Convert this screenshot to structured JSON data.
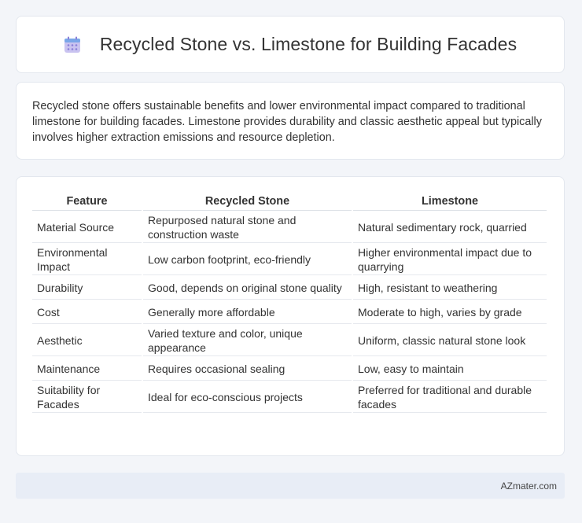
{
  "header": {
    "title": "Recycled Stone vs. Limestone for Building Facades",
    "icon": "calendar-grid-icon"
  },
  "summary": {
    "text": "Recycled stone offers sustainable benefits and lower environmental impact compared to traditional limestone for building facades. Limestone provides durability and classic aesthetic appeal but typically involves higher extraction emissions and resource depletion."
  },
  "table": {
    "headers": [
      "Feature",
      "Recycled Stone",
      "Limestone"
    ],
    "rows": [
      [
        "Material Source",
        "Repurposed natural stone and construction waste",
        "Natural sedimentary rock, quarried"
      ],
      [
        "Environmental Impact",
        "Low carbon footprint, eco-friendly",
        "Higher environmental impact due to quarrying"
      ],
      [
        "Durability",
        "Good, depends on original stone quality",
        "High, resistant to weathering"
      ],
      [
        "Cost",
        "Generally more affordable",
        "Moderate to high, varies by grade"
      ],
      [
        "Aesthetic",
        "Varied texture and color, unique appearance",
        "Uniform, classic natural stone look"
      ],
      [
        "Maintenance",
        "Requires occasional sealing",
        "Low, easy to maintain"
      ],
      [
        "Suitability for Facades",
        "Ideal for eco-conscious projects",
        "Preferred for traditional and durable facades"
      ]
    ]
  },
  "footer": {
    "text": "AZmater.com"
  }
}
